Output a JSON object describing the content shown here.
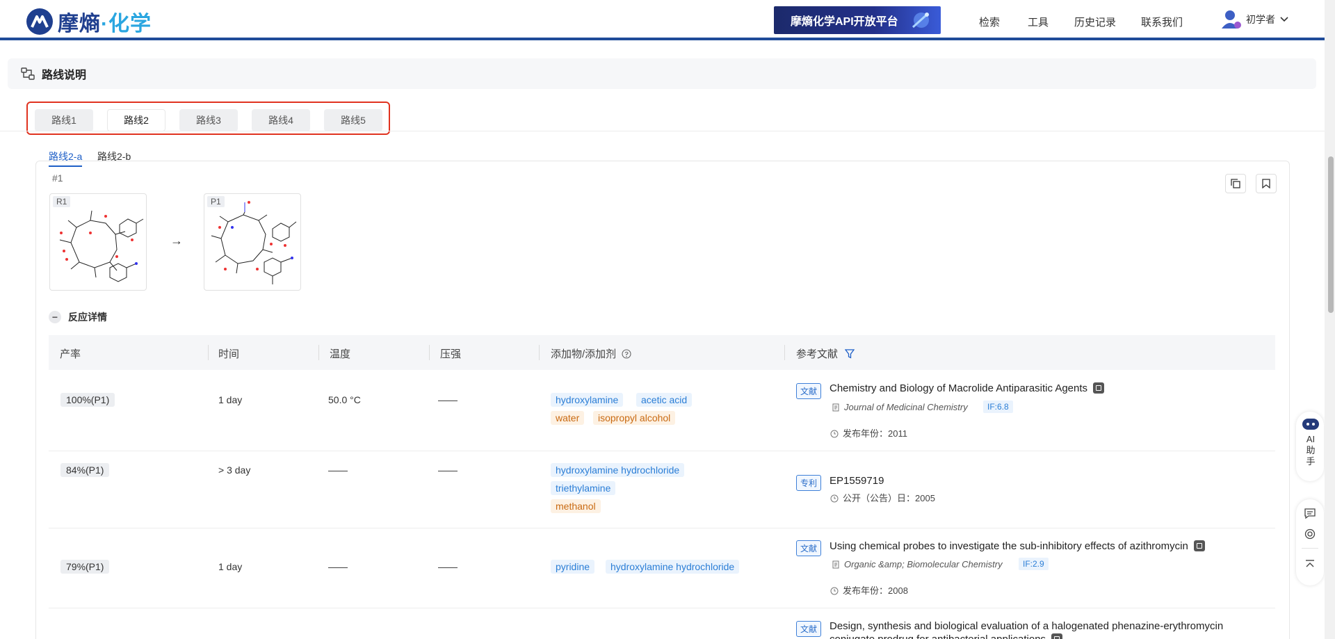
{
  "header": {
    "logo_main": "摩熵",
    "logo_dot": "·",
    "logo_accent": "化学",
    "api_banner": "摩熵化学API开放平台",
    "nav": [
      "检索",
      "工具",
      "历史记录",
      "联系我们"
    ],
    "user_name": "初学者"
  },
  "section": {
    "title": "路线说明"
  },
  "route_tabs": [
    "路线1",
    "路线2",
    "路线3",
    "路线4",
    "路线5"
  ],
  "active_route_tab": "路线2",
  "sub_tabs": [
    "路线2-a",
    "路线2-b"
  ],
  "step": {
    "number": "#1",
    "reactant_label": "R1",
    "product_label": "P1",
    "arrow": "→"
  },
  "details_toggle": {
    "symbol": "−",
    "label": "反应详情"
  },
  "table": {
    "headers": [
      "产率",
      "时间",
      "温度",
      "压强",
      "添加物/添加剂",
      "参考文献"
    ],
    "rows": [
      {
        "yield": "100%(P1)",
        "time": "1 day",
        "temp": "50.0 °C",
        "pressure": "——",
        "additives_blue": [
          "hydroxylamine",
          "acetic acid"
        ],
        "additives_orange": [
          "water",
          "isopropyl alcohol"
        ],
        "ref_type": "文献",
        "ref_title": "Chemistry and Biology of Macrolide Antiparasitic Agents",
        "journal": "Journal of Medicinal Chemistry",
        "impact": "IF:6.8",
        "date_label": "发布年份：2011"
      },
      {
        "yield": "84%(P1)",
        "time": "> 3 day",
        "temp": "——",
        "pressure": "——",
        "additives_blue": [
          "hydroxylamine hydrochloride",
          "triethylamine"
        ],
        "additives_orange": [
          "methanol"
        ],
        "ref_type": "专利",
        "ref_title": "EP1559719",
        "date_label": "公开（公告）日：2005"
      },
      {
        "yield": "79%(P1)",
        "time": "1 day",
        "temp": "——",
        "pressure": "——",
        "additives_blue": [
          "pyridine",
          "hydroxylamine hydrochloride"
        ],
        "additives_orange": [],
        "ref_type": "文献",
        "ref_title": "Using chemical probes to investigate the sub-inhibitory effects of azithromycin",
        "journal": "Organic &amp; Biomolecular Chemistry",
        "impact": "IF:2.9",
        "date_label": "发布年份：2008"
      },
      {
        "ref_type": "文献",
        "ref_title": "Design, synthesis and biological evaluation of a halogenated phenazine-erythromycin",
        "ref_title_cont": "conjugate prodrug for antibacterial applications"
      }
    ]
  },
  "side_panel": {
    "ai_label": "AI助手"
  },
  "colors": {
    "brand_navy": "#1f3f8f",
    "accent_blue": "#2aa6e0",
    "highlight_red": "#e0321f",
    "link_blue": "#1e5fc7"
  }
}
